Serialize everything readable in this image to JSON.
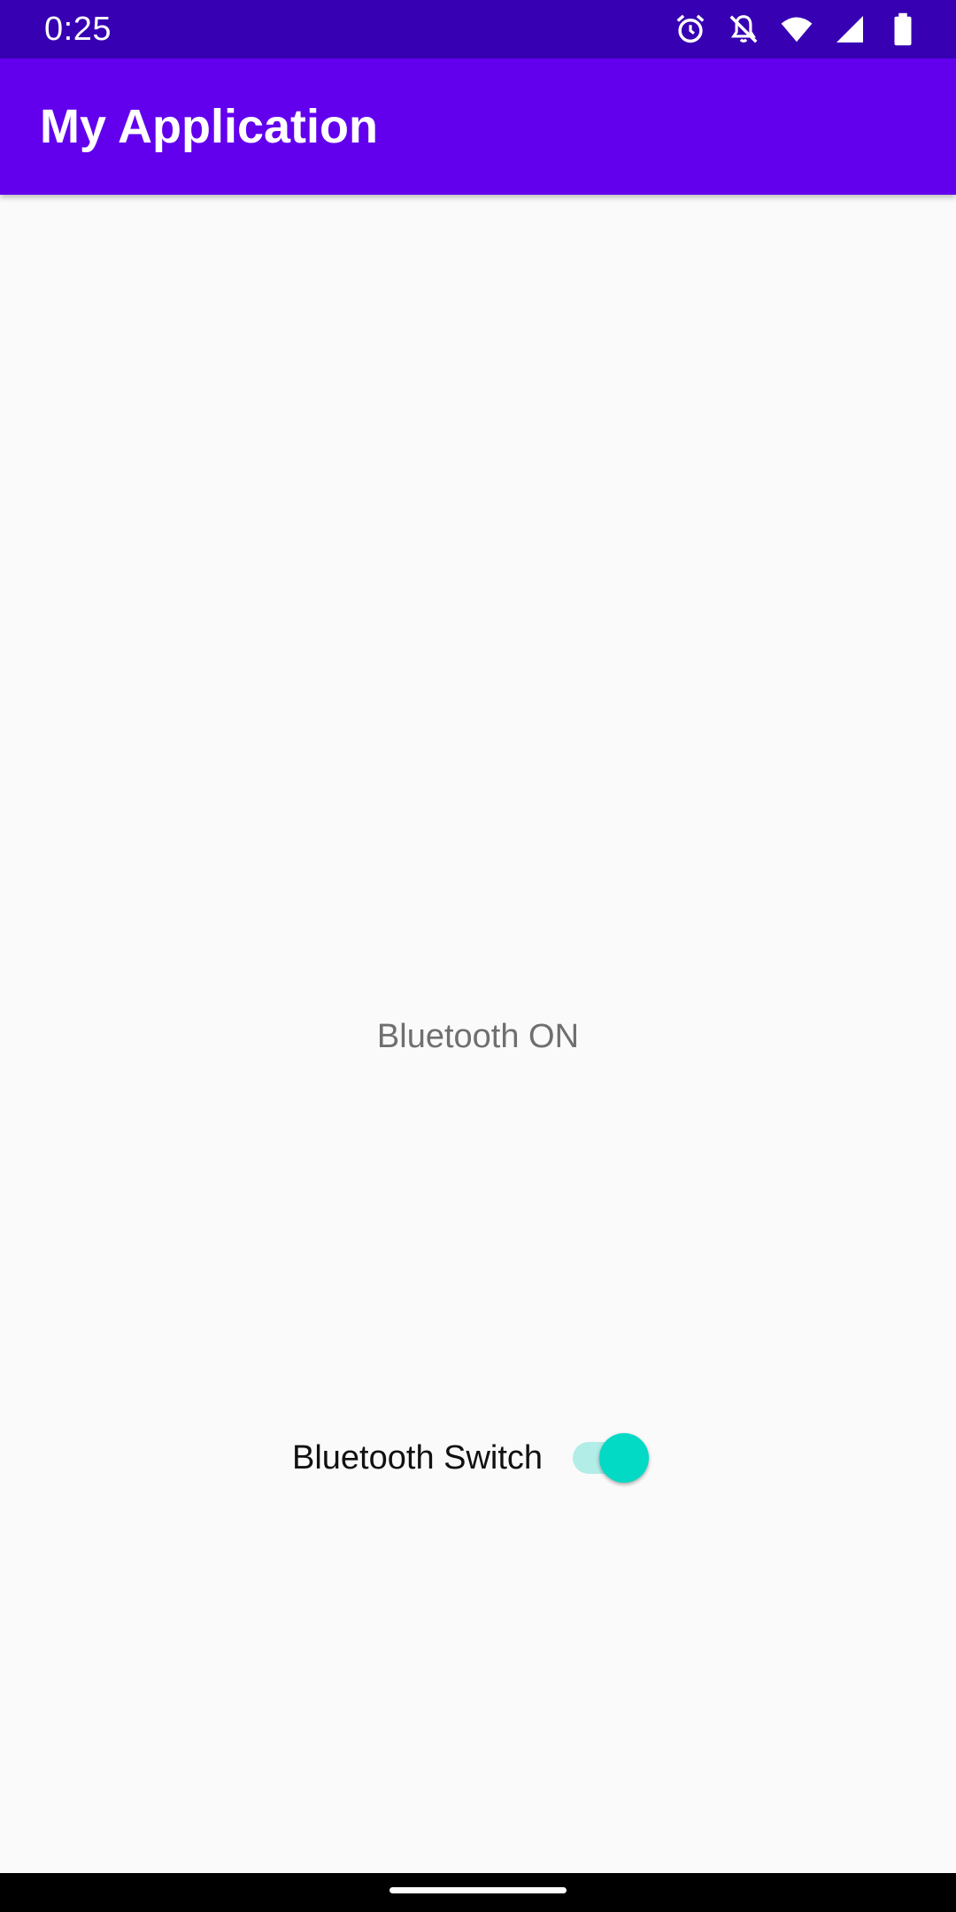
{
  "status_bar": {
    "time": "0:25",
    "icons": [
      "alarm-icon",
      "notifications-off-icon",
      "wifi-icon",
      "signal-icon",
      "battery-icon"
    ]
  },
  "app_bar": {
    "title": "My Application",
    "color": "#6200ee"
  },
  "main": {
    "bluetooth_status": "Bluetooth ON",
    "switch_label": "Bluetooth Switch",
    "switch_on": true,
    "switch_accent": "#03dac5"
  }
}
